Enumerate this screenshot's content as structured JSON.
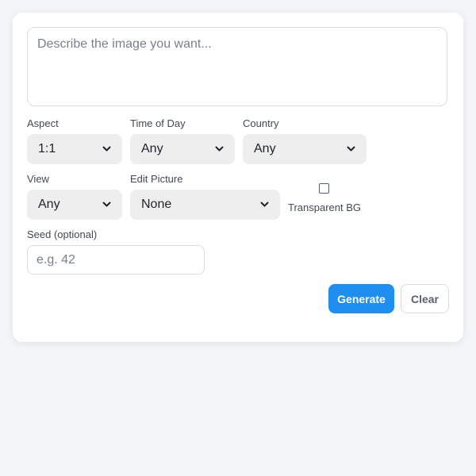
{
  "prompt": {
    "placeholder": "Describe the image you want..."
  },
  "aspect": {
    "label": "Aspect",
    "value": "1:1"
  },
  "time_of_day": {
    "label": "Time of Day",
    "value": "Any"
  },
  "country": {
    "label": "Country",
    "value": "Any"
  },
  "view": {
    "label": "View",
    "value": "Any"
  },
  "edit_picture": {
    "label": "Edit Picture",
    "value": "None"
  },
  "transparent_bg": {
    "label": "Transparent BG",
    "checked": false
  },
  "seed": {
    "label": "Seed (optional)",
    "placeholder": "e.g. 42",
    "value": ""
  },
  "buttons": {
    "generate": "Generate",
    "clear": "Clear"
  },
  "colors": {
    "accent": "#1f8ef1",
    "page_bg": "#f3f5f8",
    "select_bg": "#eeeeef"
  },
  "icons": {
    "dropdown": "chevron-down-icon"
  }
}
